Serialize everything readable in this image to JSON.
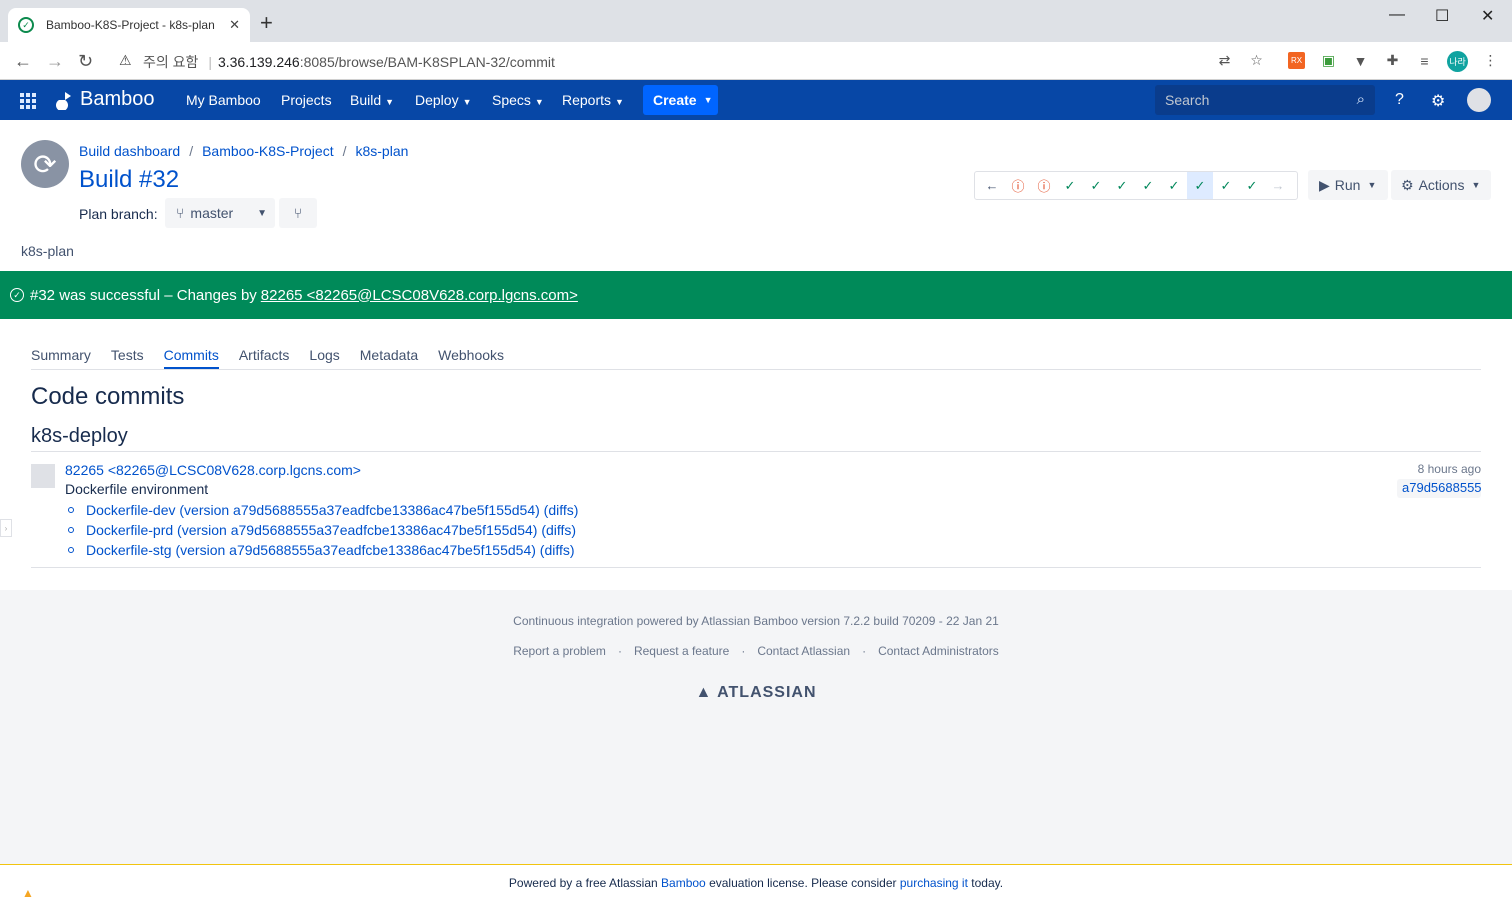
{
  "browser": {
    "tab_title": "Bamboo-K8S-Project - k8s-plan",
    "tab_close": "✕",
    "new_tab": "+",
    "security_label": "주의 요함",
    "url_host": "3.36.139.246",
    "url_rest": ":8085/browse/BAM-K8SPLAN-32/commit",
    "profile_initials": "나라"
  },
  "header": {
    "brand": "Bamboo",
    "nav": [
      {
        "label": "My Bamboo"
      },
      {
        "label": "Projects"
      },
      {
        "label": "Build"
      },
      {
        "label": "Deploy"
      },
      {
        "label": "Specs"
      },
      {
        "label": "Reports"
      }
    ],
    "create_label": "Create",
    "search_placeholder": "Search"
  },
  "breadcrumb": [
    "Build dashboard",
    "Bamboo-K8S-Project",
    "k8s-plan"
  ],
  "page_title": "Build #32",
  "plan_branch_label": "Plan branch:",
  "plan_branch_value": "master",
  "plan_name": "k8s-plan",
  "history": [
    "failed",
    "failed",
    "success",
    "success",
    "success",
    "success",
    "success",
    "success-current",
    "success",
    "success"
  ],
  "run_label": "Run",
  "actions_label": "Actions",
  "banner": {
    "text": "#32 was successful – Changes by",
    "author_link": "82265 <82265@LCSC08V628.corp.lgcns.com>"
  },
  "tabs": [
    "Summary",
    "Tests",
    "Commits",
    "Artifacts",
    "Logs",
    "Metadata",
    "Webhooks"
  ],
  "active_tab": "Commits",
  "section_title": "Code commits",
  "repo_name": "k8s-deploy",
  "commit": {
    "author": "82265 <82265@LCSC08V628.corp.lgcns.com>",
    "message": "Dockerfile environment",
    "time": "8 hours ago",
    "hash": "a79d5688555a37eadfcbe13386ac47be5f155d54",
    "files": [
      "Dockerfile-dev (version a79d5688555a37eadfcbe13386ac47be5f155d54) (diffs)",
      "Dockerfile-prd (version a79d5688555a37eadfcbe13386ac47be5f155d54) (diffs)",
      "Dockerfile-stg (version a79d5688555a37eadfcbe13386ac47be5f155d54) (diffs)"
    ]
  },
  "footer": {
    "powered": "Continuous integration powered by Atlassian Bamboo version 7.2.2 build 70209 - 22 Jan 21",
    "links": [
      "Report a problem",
      "Request a feature",
      "Contact Atlassian",
      "Contact Administrators"
    ],
    "separator": "·",
    "atlassian": "ATLASSIAN"
  },
  "eval_bar": {
    "prefix": "Powered by a free Atlassian",
    "bamboo_link": "Bamboo",
    "middle": "evaluation license. Please consider",
    "purchase_link": "purchasing it",
    "suffix": "today."
  }
}
